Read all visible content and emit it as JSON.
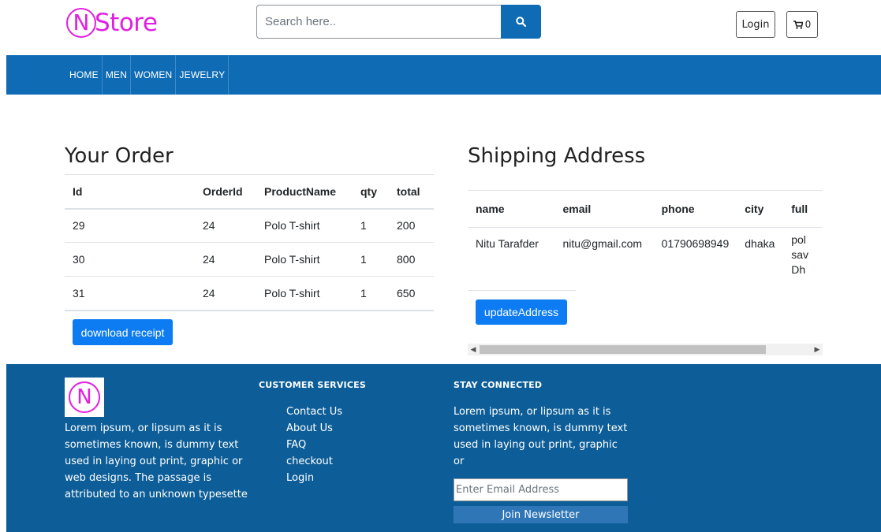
{
  "colors": {
    "brand": "#e020e0",
    "primary": "#0f6cb4",
    "button": "#0d7cf2",
    "footer": "#0d5e98"
  },
  "header": {
    "logo_mark": "N",
    "logo_text": "Store",
    "search_placeholder": "Search here..",
    "search_icon": "search-icon",
    "login_label": "Login",
    "cart_icon": "shopping-cart-icon",
    "cart_count": "0"
  },
  "nav": {
    "items": [
      "HOME",
      "MEN",
      "WOMEN",
      "JEWELRY"
    ]
  },
  "order": {
    "title": "Your Order",
    "columns": [
      "Id",
      "OrderId",
      "ProductName",
      "qty",
      "total"
    ],
    "rows": [
      [
        "29",
        "24",
        "Polo T-shirt",
        "1",
        "200"
      ],
      [
        "30",
        "24",
        "Polo T-shirt",
        "1",
        "800"
      ],
      [
        "31",
        "24",
        "Polo T-shirt",
        "1",
        "650"
      ]
    ],
    "download_label": "download receipt"
  },
  "shipping": {
    "title": "Shipping Address",
    "columns": [
      "name",
      "email",
      "phone",
      "city",
      "full"
    ],
    "row": {
      "name": "Nitu Tarafder",
      "email": "nitu@gmail.com",
      "phone": "01790698949",
      "city": "dhaka",
      "full": "pol sav Dh"
    },
    "update_label": "updateAddress"
  },
  "footer": {
    "logo_mark": "N",
    "about_text": "Lorem ipsum, or lipsum as it is sometimes known, is dummy text used in laying out print, graphic or web designs. The passage is attributed to an unknown typesette",
    "services_heading": "CUSTOMER SERVICES",
    "links": [
      "Contact Us",
      "About Us",
      "FAQ",
      "checkout",
      "Login"
    ],
    "stay_heading": "STAY CONNECTED",
    "stay_text": "Lorem ipsum, or lipsum as it is sometimes known, is dummy text used in laying out print, graphic or",
    "email_placeholder": "Enter Email Address",
    "join_label": "Join Newsletter"
  }
}
